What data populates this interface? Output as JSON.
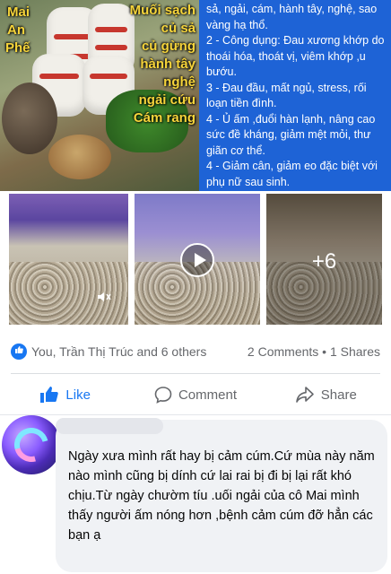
{
  "post_image": {
    "labels_left": [
      "Mai",
      "An",
      "Phế"
    ],
    "labels_right": [
      "Muối sạch",
      "củ sả",
      "củ gừng",
      "hành tây",
      "nghệ",
      "ngải cứu",
      "Cám rang"
    ],
    "info_text": "sả, ngải, cám, hành tây, nghệ, sao vàng hạ thổ.\n2 - Công dụng: Đau xương khớp do thoái hóa, thoát vị, viêm khớp ,u bướu.\n3 - Đau đầu, mất ngủ, stress, rối loạn tiền đình.\n4 - Ủ ấm ,đuổi hàn lạnh, nâng cao sức đề kháng, giảm mệt mỏi, thư giãn cơ thể.\n4 - Giảm cân, giảm eo đặc biệt với phụ nữ sau sinh.\n#Thiết kế đặc biệt có đai dính, có"
  },
  "gallery": {
    "more_count": "+6",
    "icons": {
      "mute": "mute-icon",
      "play": "play-icon"
    }
  },
  "reactions": {
    "summary": "You, Trần Thị Trúc and 6 others",
    "counts": "2 Comments • 1 Shares",
    "icon": "like-badge-icon"
  },
  "actions": {
    "like": "Like",
    "comment": "Comment",
    "share": "Share"
  },
  "comment": {
    "text": "Ngày xưa mình rất hay bị cảm cúm.Cứ mùa này năm nào mình cũng bị dính cứ lai rai bị đi bị lại rất khó chịu.Từ ngày chườm tíu .uối ngải của cô Mai mình thấy người ấm nóng hơn ,bệnh cảm cúm đỡ hẳn các bạn ạ"
  },
  "colors": {
    "brand_blue": "#1877f2",
    "panel_blue": "#1e63d6",
    "overlay_yellow": "#f6d43a"
  }
}
